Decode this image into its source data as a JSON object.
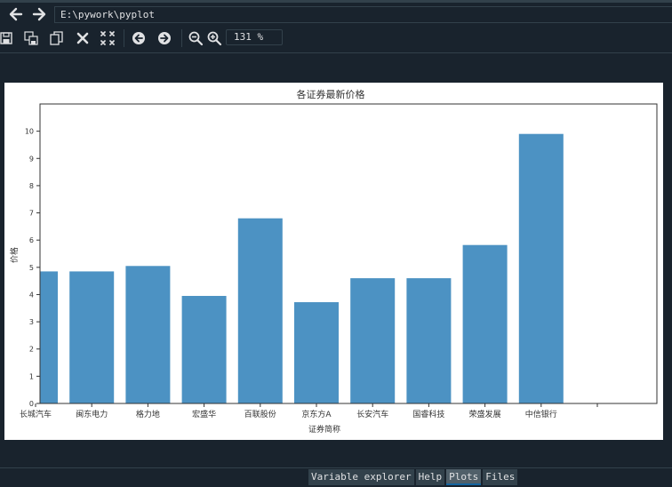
{
  "path": {
    "value": "E:\\pywork\\pyplot"
  },
  "toolbar": {
    "icons": [
      "save-icon",
      "save-all-icon",
      "copy-icon",
      "close-icon",
      "close-all-icon",
      "previous-icon",
      "next-icon",
      "zoom-out-icon",
      "zoom-in-icon"
    ],
    "zoom_value": "131 %"
  },
  "tabs": [
    {
      "label": "Variable explorer",
      "active": false
    },
    {
      "label": "Help",
      "active": false
    },
    {
      "label": "Plots",
      "active": true
    },
    {
      "label": "Files",
      "active": false
    }
  ],
  "chart_data": {
    "type": "bar",
    "title": "各证券最新价格",
    "xlabel": "证券简称",
    "ylabel": "价格",
    "categories": [
      "长城汽车",
      "闽东电力",
      "格力地",
      "宏盛华",
      "百联股份",
      "京东方A",
      "长安汽车",
      "国睿科技",
      "荣盛发展",
      "中信银行"
    ],
    "values": [
      4.85,
      4.85,
      5.05,
      3.95,
      6.8,
      3.72,
      4.6,
      4.6,
      5.82,
      9.9
    ],
    "ylim": [
      0,
      11
    ],
    "yticks": [
      0,
      1,
      2,
      3,
      4,
      5,
      6,
      7,
      8,
      9,
      10
    ],
    "color": "#4c92c3",
    "grid": false
  }
}
